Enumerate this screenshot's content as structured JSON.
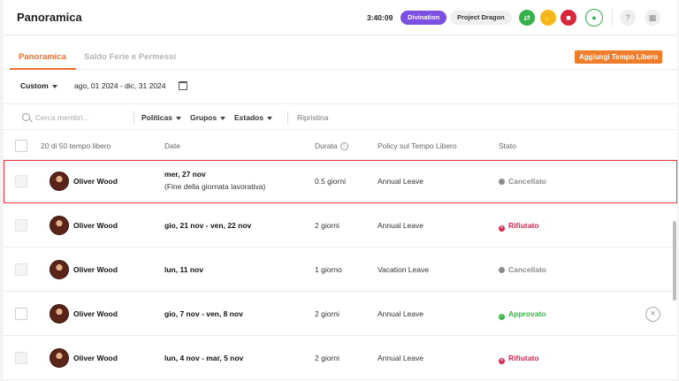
{
  "header": {
    "title": "Panoramica",
    "clock": "3:40:09",
    "workspace_chip": "Divination",
    "project_chip": "Project Dragon"
  },
  "tabs": [
    {
      "label": "Panoramica",
      "active": true
    },
    {
      "label": "Saldo Ferie e Permessi",
      "active": false
    }
  ],
  "add_button_label": "Aggiungi Tempo Libero",
  "date_range": {
    "selector": "Custom",
    "value": "ago, 01 2024 - dic, 31 2024"
  },
  "filters": {
    "search_placeholder": "Cerca membri...",
    "policies": "Políticas",
    "groups": "Grupos",
    "states": "Estados",
    "reset": "Ripristina"
  },
  "columns": {
    "count": "20 di 50 tempo libero",
    "date": "Date",
    "duration": "Durata",
    "policy": "Policy sul Tempo Libero",
    "status": "Stato"
  },
  "rows": [
    {
      "name": "Oliver Wood",
      "date": "mer, 27 nov",
      "note": "(Fine della giornata lavorativa)",
      "duration": "0.5 giorni",
      "policy": "Annual Leave",
      "status": "Cancellato",
      "status_color": "#8c8c8c"
    },
    {
      "name": "Oliver Wood",
      "date": "gio, 21 nov - ven, 22 nov",
      "note": "",
      "duration": "2 giorni",
      "policy": "Annual Leave",
      "status": "Rifiutato",
      "status_color": "#d62a52"
    },
    {
      "name": "Oliver Wood",
      "date": "lun, 11 nov",
      "note": "",
      "duration": "1 giorno",
      "policy": "Vacation Leave",
      "status": "Cancellato",
      "status_color": "#8c8c8c"
    },
    {
      "name": "Oliver Wood",
      "date": "gio, 7 nov - ven, 8 nov",
      "note": "",
      "duration": "2 giorni",
      "policy": "Annual Leave",
      "status": "Approvato",
      "status_color": "#3cb64a"
    },
    {
      "name": "Oliver Wood",
      "date": "lun, 4 nov - mar, 5 nov",
      "note": "",
      "duration": "2 giorni",
      "policy": "Annual Leave",
      "status": "Rifiutato",
      "status_color": "#d62a52"
    }
  ],
  "icons": {
    "top_buttons": [
      "sync-icon",
      "thumb-icon",
      "stop-icon",
      "user-icon",
      "help-icon",
      "apps-icon"
    ],
    "status": [
      "status-dot-icon"
    ],
    "row_action": "close-circle-icon"
  }
}
